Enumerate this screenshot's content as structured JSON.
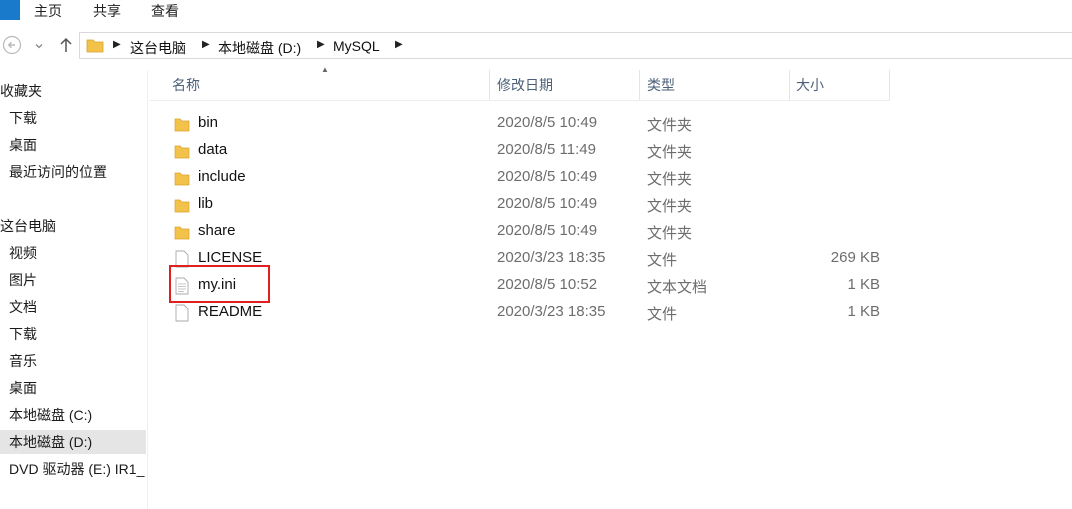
{
  "ribbon": {
    "tabs": [
      "主页",
      "共享",
      "查看"
    ]
  },
  "address": {
    "crumbs": [
      "这台电脑",
      "本地磁盘 (D:)",
      "MySQL"
    ]
  },
  "sidebar": {
    "items": [
      {
        "label": "收藏夹",
        "icon": "star-icon"
      },
      {
        "label": "下载",
        "icon": "download-folder-icon"
      },
      {
        "label": "桌面",
        "icon": "desktop-icon"
      },
      {
        "label": "最近访问的位置",
        "icon": "recent-places-icon"
      },
      {
        "label": "这台电脑",
        "icon": "computer-icon"
      },
      {
        "label": "视频",
        "icon": "videos-icon"
      },
      {
        "label": "图片",
        "icon": "pictures-icon"
      },
      {
        "label": "文档",
        "icon": "documents-icon"
      },
      {
        "label": "下载",
        "icon": "download-folder-icon"
      },
      {
        "label": "音乐",
        "icon": "music-icon"
      },
      {
        "label": "桌面",
        "icon": "desktop-icon"
      },
      {
        "label": "本地磁盘 (C:)",
        "icon": "drive-icon"
      },
      {
        "label": "本地磁盘 (D:)",
        "icon": "drive-icon",
        "selected": true
      },
      {
        "label": "DVD 驱动器 (E:) IR1_",
        "icon": "dvd-icon"
      }
    ]
  },
  "columns": {
    "name": "名称",
    "date": "修改日期",
    "type": "类型",
    "size": "大小"
  },
  "files": [
    {
      "name": "bin",
      "date": "2020/8/5 10:49",
      "type": "文件夹",
      "size": "",
      "kind": "folder"
    },
    {
      "name": "data",
      "date": "2020/8/5 11:49",
      "type": "文件夹",
      "size": "",
      "kind": "folder"
    },
    {
      "name": "include",
      "date": "2020/8/5 10:49",
      "type": "文件夹",
      "size": "",
      "kind": "folder"
    },
    {
      "name": "lib",
      "date": "2020/8/5 10:49",
      "type": "文件夹",
      "size": "",
      "kind": "folder"
    },
    {
      "name": "share",
      "date": "2020/8/5 10:49",
      "type": "文件夹",
      "size": "",
      "kind": "folder"
    },
    {
      "name": "LICENSE",
      "date": "2020/3/23 18:35",
      "type": "文件",
      "size": "269 KB",
      "kind": "file"
    },
    {
      "name": "my.ini",
      "date": "2020/8/5 10:52",
      "type": "文本文档",
      "size": "1 KB",
      "kind": "text",
      "highlighted": true
    },
    {
      "name": "README",
      "date": "2020/3/23 18:35",
      "type": "文件",
      "size": "1 KB",
      "kind": "file"
    }
  ],
  "colors": {
    "accent": "#1979ca",
    "folder": "#f3c24a",
    "highlight": "#e02020",
    "selected_bg": "#e5e5e5"
  }
}
